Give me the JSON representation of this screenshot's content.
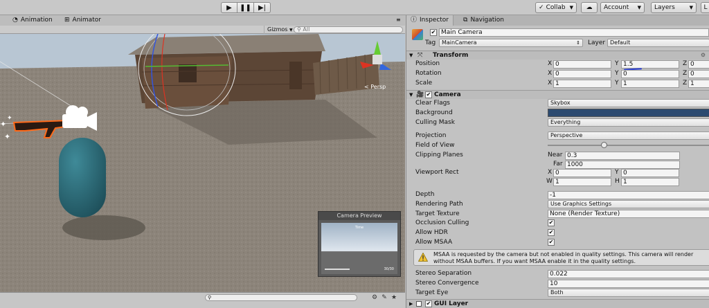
{
  "toolbar": {
    "collab_label": "Collab",
    "cloud_icon": "cloud-icon",
    "account_label": "Account",
    "layers_label": "Layers",
    "layout_label": "L"
  },
  "left_tabs": {
    "animation_label": "Animation",
    "animator_label": "Animator",
    "gizmos_label": "Gizmos",
    "search_placeholder": "All"
  },
  "scene": {
    "persp_label": "< Persp",
    "camera_preview_title": "Camera Preview",
    "camera_preview_time": "Time",
    "camera_preview_fps": "30/30"
  },
  "inspector": {
    "tabs": [
      {
        "label": "Inspector",
        "icon": "info-icon"
      },
      {
        "label": "Navigation",
        "icon": "navigation-icon"
      }
    ],
    "object": {
      "active": true,
      "name": "Main Camera",
      "tag_label": "Tag",
      "tag_value": "MainCamera",
      "layer_label": "Layer",
      "layer_value": "Default"
    },
    "transform": {
      "title": "Transform",
      "position_label": "Position",
      "rotation_label": "Rotation",
      "scale_label": "Scale",
      "position": {
        "x": "0",
        "y": "1.5",
        "z": "0"
      },
      "rotation": {
        "x": "0",
        "y": "0",
        "z": "0"
      },
      "scale": {
        "x": "1",
        "y": "1",
        "z": "1"
      }
    },
    "camera": {
      "title": "Camera",
      "clear_flags_label": "Clear Flags",
      "clear_flags_value": "Skybox",
      "background_label": "Background",
      "background_color": "#2c4a70",
      "culling_mask_label": "Culling Mask",
      "culling_mask_value": "Everything",
      "projection_label": "Projection",
      "projection_value": "Perspective",
      "fov_label": "Field of View",
      "fov_fraction": 0.35,
      "clipping_label": "Clipping Planes",
      "near_label": "Near",
      "near_value": "0.3",
      "far_label": "Far",
      "far_value": "1000",
      "viewport_label": "Viewport Rect",
      "viewport": {
        "x": "0",
        "y": "0",
        "w": "1",
        "h": "1"
      },
      "depth_label": "Depth",
      "depth_value": "-1",
      "rendering_path_label": "Rendering Path",
      "rendering_path_value": "Use Graphics Settings",
      "target_texture_label": "Target Texture",
      "target_texture_value": "None (Render Texture)",
      "occlusion_label": "Occlusion Culling",
      "hdr_label": "Allow HDR",
      "msaa_label": "Allow MSAA",
      "warning_text": "MSAA is requested by the camera but not enabled in quality settings. This camera will render without MSAA buffers. If you want MSAA enable it in the quality settings.",
      "stereo_sep_label": "Stereo Separation",
      "stereo_sep_value": "0.022",
      "stereo_conv_label": "Stereo Convergence",
      "stereo_conv_value": "10",
      "target_eye_label": "Target Eye",
      "target_eye_value": "Both"
    },
    "gui_layer": {
      "title": "GUI Layer"
    }
  },
  "axes": {
    "x": "X",
    "y": "Y",
    "z": "Z",
    "w": "W",
    "h": "H"
  }
}
